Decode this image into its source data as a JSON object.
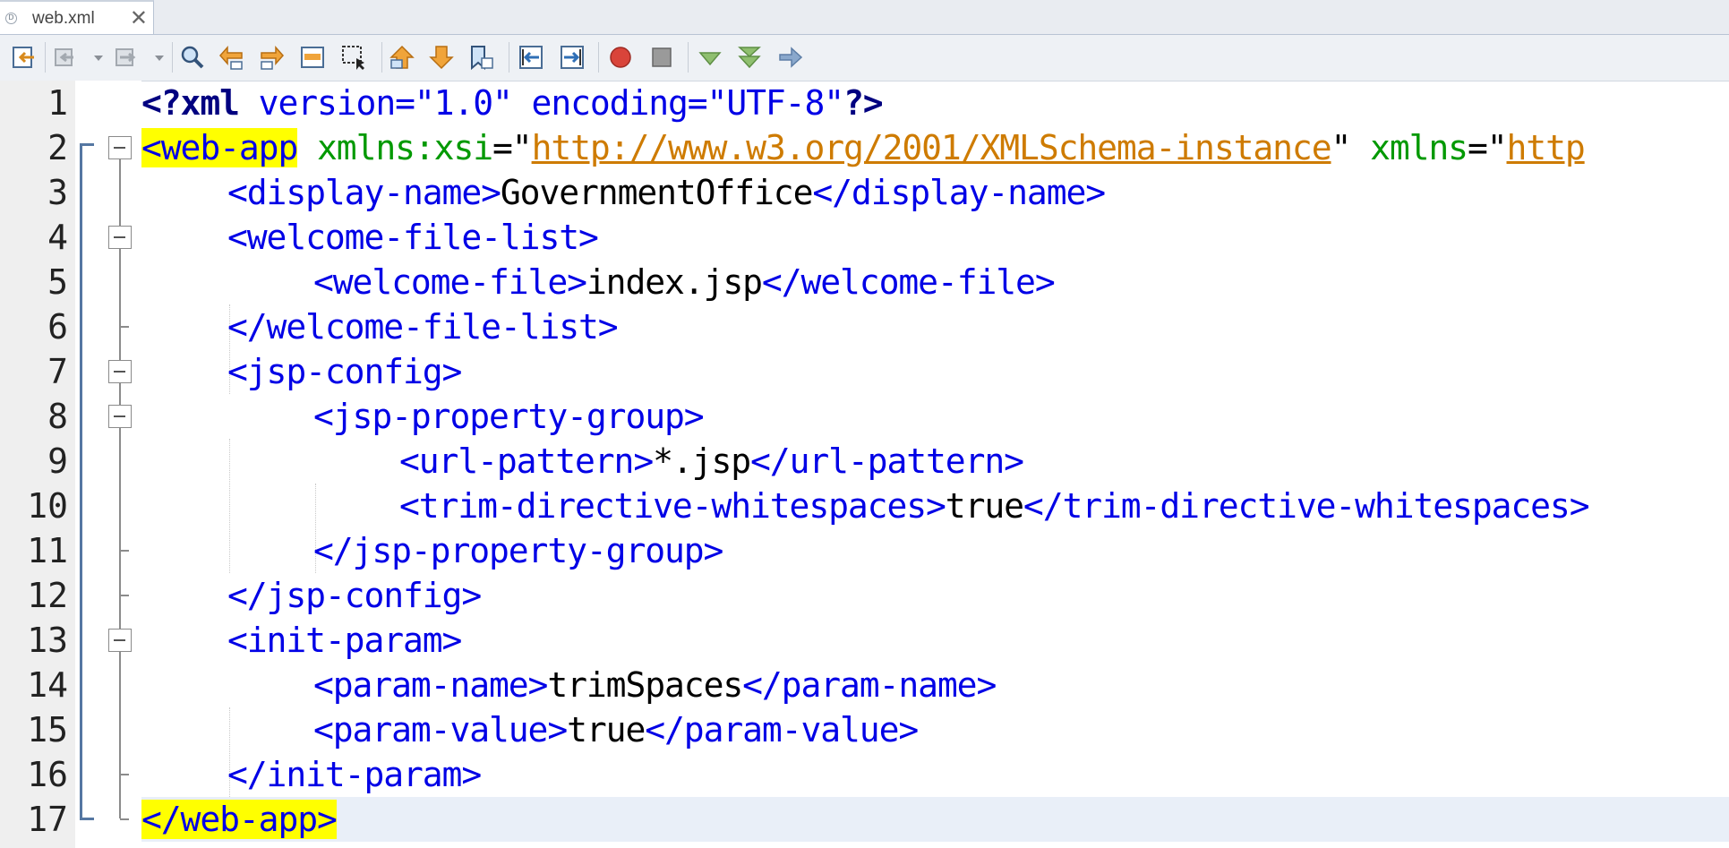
{
  "tab": {
    "label": "web.xml",
    "close": "✕",
    "icon": "xml-file-icon"
  },
  "toolbar": {
    "buttons": [
      "last-edit-icon",
      "back-icon",
      "forward-icon",
      "find-selection-icon",
      "find-previous-icon",
      "find-next-icon",
      "toggle-highlight-icon",
      "toggle-rect-selection-icon",
      "previous-bookmark-icon",
      "next-bookmark-icon",
      "toggle-bookmark-icon",
      "shift-left-icon",
      "shift-right-icon",
      "start-macro-icon",
      "stop-macro-icon",
      "check-xml-icon",
      "validate-xml-icon",
      "xsl-transform-icon"
    ]
  },
  "editor": {
    "line_numbers": [
      "1",
      "2",
      "3",
      "4",
      "5",
      "6",
      "7",
      "8",
      "9",
      "10",
      "11",
      "12",
      "13",
      "14",
      "15",
      "16",
      "17"
    ],
    "lines": {
      "l1": {
        "a": "<?xml",
        "b": " version=\"1.0\" encoding=\"UTF-8\"",
        "c": "?>"
      },
      "l2": {
        "tag": "<web-app",
        "sp": " ",
        "xsi_name": "xmlns:xsi",
        "eq1": "=\"",
        "xsi_url": "http://www.w3.org/2001/XMLSchema-instance",
        "q1": "\" ",
        "xmlns_name": "xmlns",
        "eq2": "=\"",
        "xmlns_url": "http"
      },
      "l3": {
        "open": "<display-name>",
        "text": "GovernmentOffice",
        "close": "</display-name>"
      },
      "l4": {
        "open": "<welcome-file-list>"
      },
      "l5": {
        "open": "<welcome-file>",
        "text": "index.jsp",
        "close": "</welcome-file>"
      },
      "l6": {
        "close": "</welcome-file-list>"
      },
      "l7": {
        "open": "<jsp-config>"
      },
      "l8": {
        "open": "<jsp-property-group>"
      },
      "l9": {
        "open": "<url-pattern>",
        "text": "*.jsp",
        "close": "</url-pattern>"
      },
      "l10": {
        "open": "<trim-directive-whitespaces>",
        "text": "true",
        "close": "</trim-directive-whitespaces>"
      },
      "l11": {
        "close": "</jsp-property-group>"
      },
      "l12": {
        "close": "</jsp-config>"
      },
      "l13": {
        "open": "<init-param>"
      },
      "l14": {
        "open": "<param-name>",
        "text": "trimSpaces",
        "close": "</param-name>"
      },
      "l15": {
        "open": "<param-value>",
        "text": "true",
        "close": "</param-value>"
      },
      "l16": {
        "close": "</init-param>"
      },
      "l17": {
        "close": "</web-app>"
      }
    }
  },
  "colors": {
    "tag": "#0000e6",
    "attr_name": "#009900",
    "attr_value": "#ce7b00",
    "match_highlight": "#ffff00",
    "current_line": "#e9eff8",
    "gutter": "#efefef"
  }
}
